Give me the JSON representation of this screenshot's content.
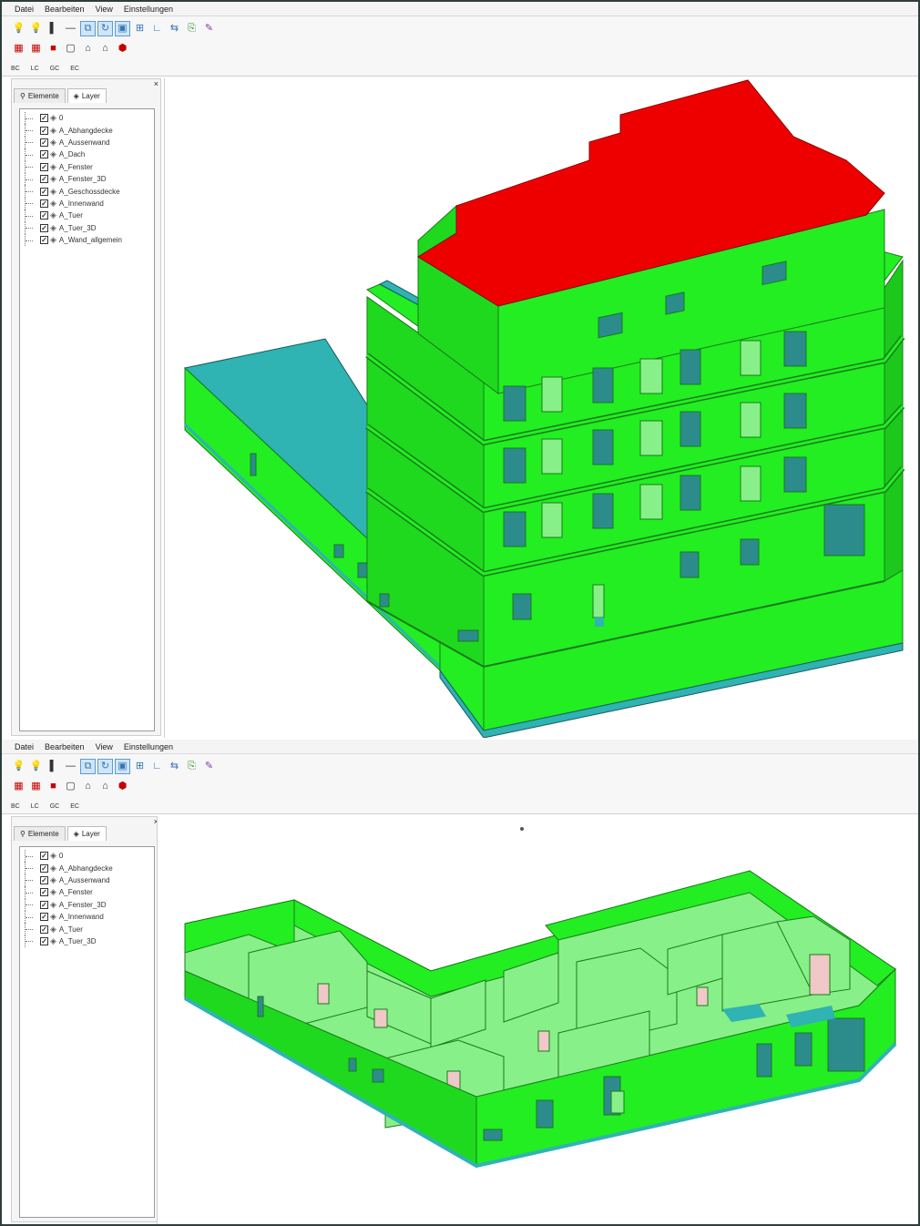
{
  "menu": [
    "Datei",
    "Bearbeiten",
    "View",
    "Einstellungen"
  ],
  "toolbar_icons": [
    "light-bulb-off-icon",
    "light-bulb-on-icon",
    "color-bar-icon",
    "line-icon",
    "select-icon",
    "rotate-icon",
    "render-mode-icon",
    "grid-icon",
    "axis-icon",
    "measure-icon",
    "export-icon",
    "pen-icon"
  ],
  "toolbar2_icons": [
    "red-wall-icon",
    "red-wall-2-icon",
    "red-block-icon",
    "window-icon",
    "house-icon",
    "house-2-icon",
    "house-red-icon"
  ],
  "toolbar_small": [
    "BC",
    "LC",
    "GC",
    "EC"
  ],
  "panel": {
    "tab_elements": "Elemente",
    "tab_layer": "Layer",
    "close": "×"
  },
  "layers_top": [
    "0",
    "A_Abhangdecke",
    "A_Aussenwand",
    "A_Dach",
    "A_Fenster",
    "A_Fenster_3D",
    "A_Geschossdecke",
    "A_Innenwand",
    "A_Tuer",
    "A_Tuer_3D",
    "A_Wand_allgemein"
  ],
  "layers_bottom": [
    "0",
    "A_Abhangdecke",
    "A_Aussenwand",
    "A_Fenster",
    "A_Fenster_3D",
    "A_Innenwand",
    "A_Tuer",
    "A_Tuer_3D"
  ],
  "colors": {
    "wall": "#22ee22",
    "wall_dark": "#1fd91f",
    "roof": "#ee0000",
    "floor_slab": "#2fb3b3",
    "window_glass": "#2c8c8c",
    "inner_wall": "#88f088",
    "door_pink": "#f0c8c8"
  }
}
